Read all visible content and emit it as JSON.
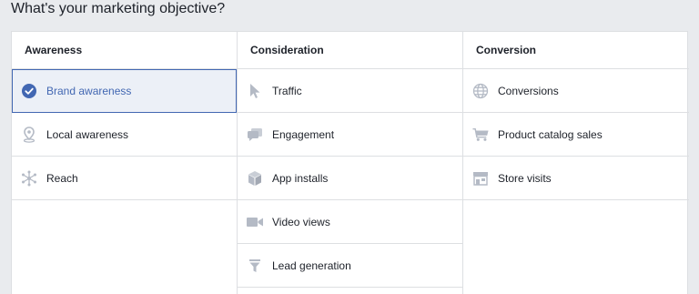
{
  "heading": "What's your marketing objective?",
  "accent_color": "#4267b2",
  "icon_color": "#b4bac5",
  "columns": [
    {
      "title": "Awareness",
      "items": [
        {
          "label": "Brand awareness",
          "icon": "checkmark-circle-icon",
          "selected": true
        },
        {
          "label": "Local awareness",
          "icon": "map-pin-icon",
          "selected": false
        },
        {
          "label": "Reach",
          "icon": "snowflake-reach-icon",
          "selected": false
        }
      ]
    },
    {
      "title": "Consideration",
      "items": [
        {
          "label": "Traffic",
          "icon": "cursor-icon",
          "selected": false
        },
        {
          "label": "Engagement",
          "icon": "chat-bubbles-icon",
          "selected": false
        },
        {
          "label": "App installs",
          "icon": "box-icon",
          "selected": false
        },
        {
          "label": "Video views",
          "icon": "video-camera-icon",
          "selected": false
        },
        {
          "label": "Lead generation",
          "icon": "funnel-icon",
          "selected": false
        }
      ]
    },
    {
      "title": "Conversion",
      "items": [
        {
          "label": "Conversions",
          "icon": "globe-icon",
          "selected": false
        },
        {
          "label": "Product catalog sales",
          "icon": "shopping-cart-icon",
          "selected": false
        },
        {
          "label": "Store visits",
          "icon": "storefront-icon",
          "selected": false
        }
      ]
    }
  ]
}
